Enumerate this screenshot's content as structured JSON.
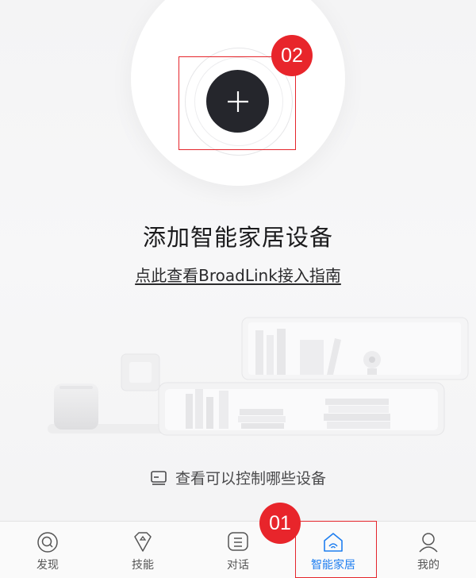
{
  "hero": {
    "add_button": "add-device",
    "step_badge": "02"
  },
  "title": "添加智能家居设备",
  "guide_link": "点此查看BroadLink接入指南",
  "supported_devices": {
    "icon": "device-list-icon",
    "label": "查看可以控制哪些设备"
  },
  "tabbar": {
    "step_badge": "01",
    "tabs": [
      {
        "label": "发现",
        "icon": "discover-icon",
        "active": false
      },
      {
        "label": "技能",
        "icon": "skills-icon",
        "active": false
      },
      {
        "label": "对话",
        "icon": "chat-icon",
        "active": false
      },
      {
        "label": "智能家居",
        "icon": "smart-home-icon",
        "active": true
      },
      {
        "label": "我的",
        "icon": "profile-icon",
        "active": false
      }
    ]
  },
  "colors": {
    "accent": "#1e7ef0",
    "badge": "#e8252b",
    "button": "#25262c"
  }
}
